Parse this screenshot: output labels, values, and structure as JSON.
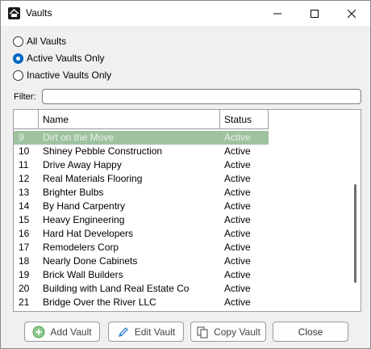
{
  "window": {
    "title": "Vaults"
  },
  "filter_options": [
    {
      "label": "All Vaults",
      "checked": false
    },
    {
      "label": "Active Vaults Only",
      "checked": true
    },
    {
      "label": "Inactive Vaults Only",
      "checked": false
    }
  ],
  "filter": {
    "label": "Filter:",
    "value": ""
  },
  "grid": {
    "columns": [
      "",
      "Name",
      "Status"
    ],
    "selected_index": 0,
    "rows": [
      {
        "id": "9",
        "name": "Dirt on the Move",
        "status": "Active"
      },
      {
        "id": "10",
        "name": "Shiney Pebble Construction",
        "status": "Active"
      },
      {
        "id": "11",
        "name": "Drive Away Happy",
        "status": "Active"
      },
      {
        "id": "12",
        "name": "Real Materials Flooring",
        "status": "Active"
      },
      {
        "id": "13",
        "name": "Brighter Bulbs",
        "status": "Active"
      },
      {
        "id": "14",
        "name": "By Hand Carpentry",
        "status": "Active"
      },
      {
        "id": "15",
        "name": "Heavy Engineering",
        "status": "Active"
      },
      {
        "id": "16",
        "name": "Hard Hat Developers",
        "status": "Active"
      },
      {
        "id": "17",
        "name": "Remodelers Corp",
        "status": "Active"
      },
      {
        "id": "18",
        "name": "Nearly Done Cabinets",
        "status": "Active"
      },
      {
        "id": "19",
        "name": "Brick Wall Builders",
        "status": "Active"
      },
      {
        "id": "20",
        "name": "Building with Land Real Estate Co",
        "status": "Active"
      },
      {
        "id": "21",
        "name": "Bridge Over the River LLC",
        "status": "Active"
      }
    ]
  },
  "buttons": {
    "add": "Add Vault",
    "edit": "Edit Vault",
    "copy": "Copy Vault",
    "close": "Close"
  },
  "icons": {
    "app": "house-app-icon",
    "add": "plus-circle-icon",
    "edit": "pencil-icon",
    "copy": "copy-icon"
  },
  "colors": {
    "selected_row": "#9fc29f",
    "radio_accent": "#0067c0"
  }
}
